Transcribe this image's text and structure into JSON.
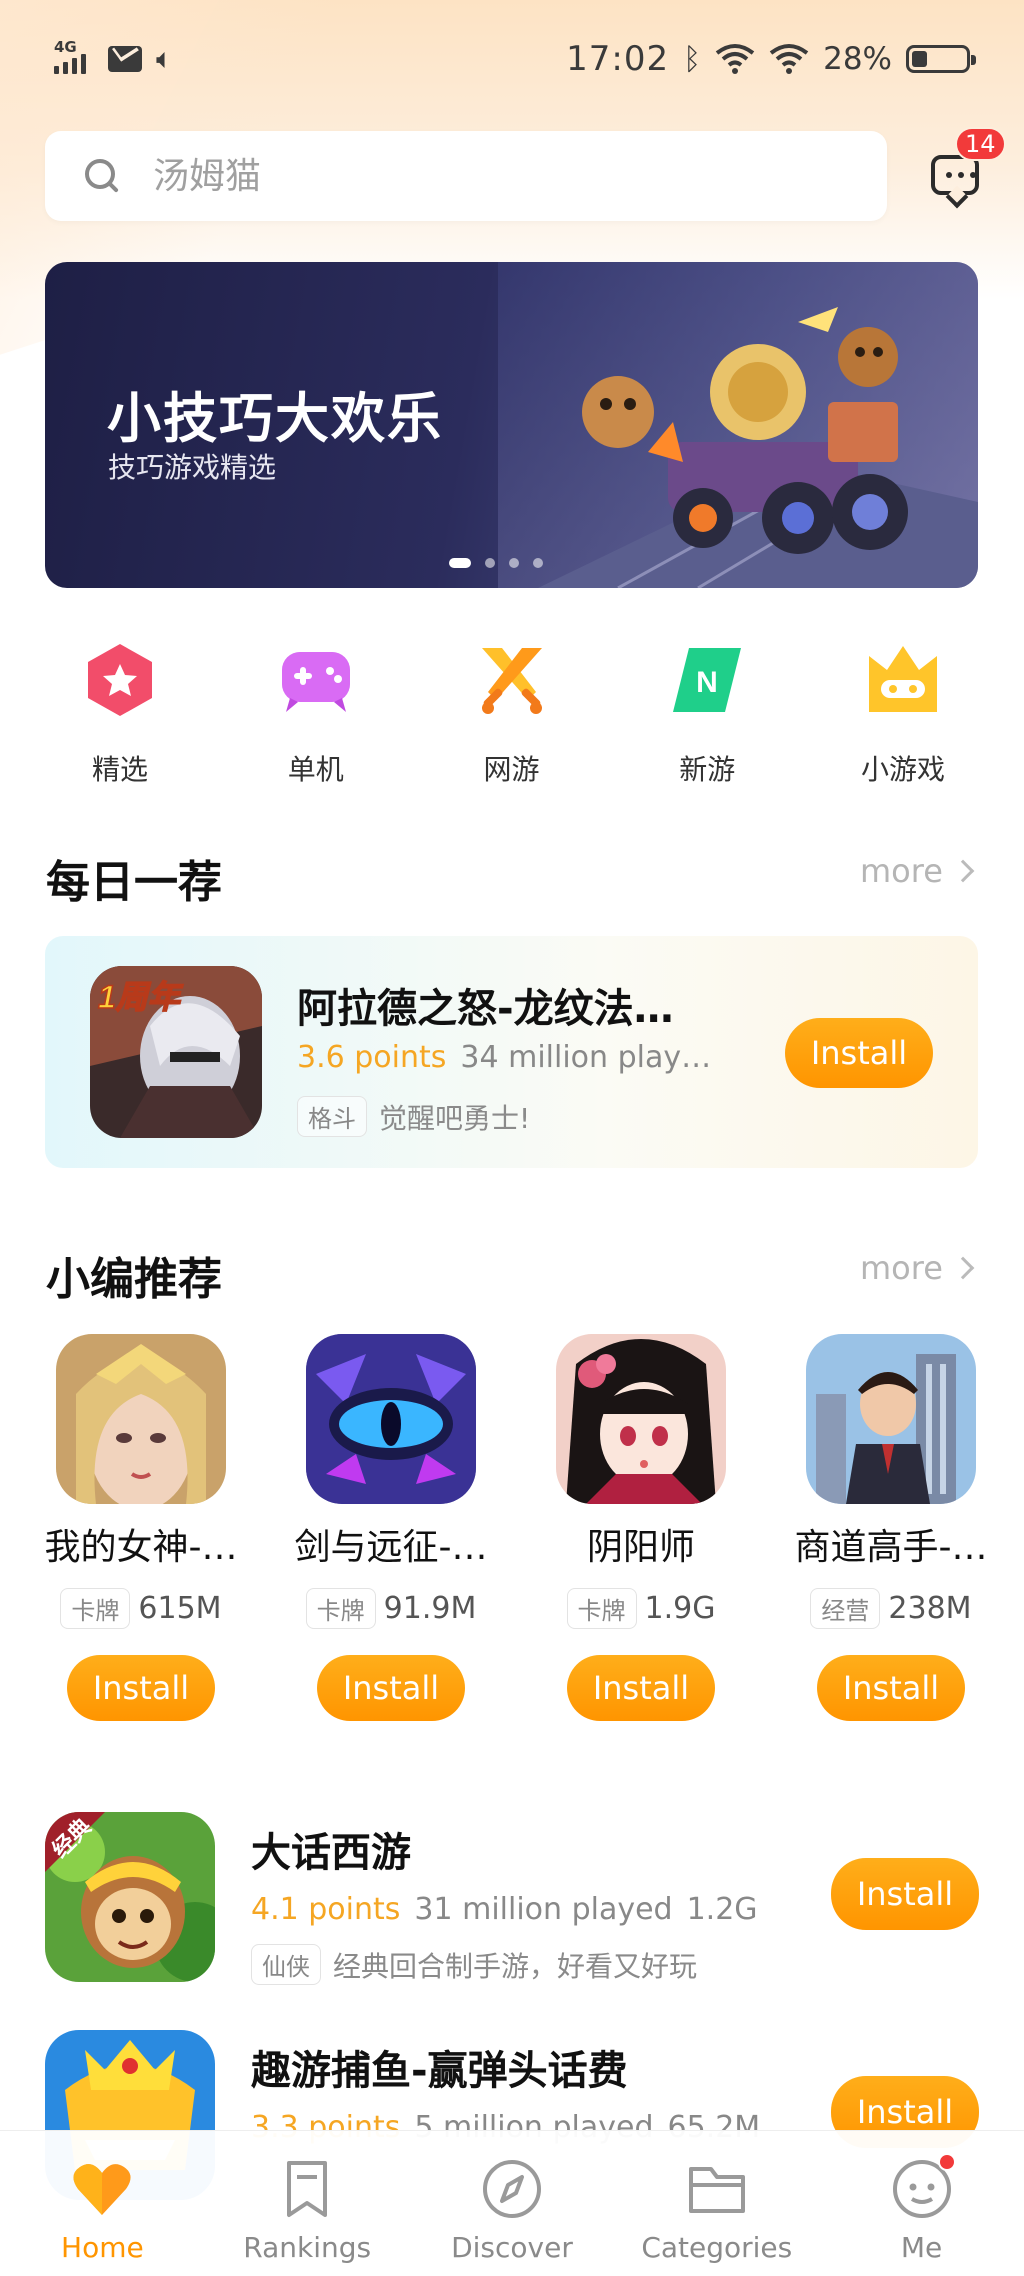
{
  "status_bar": {
    "network": "4G",
    "time": "17:02",
    "battery": "28%",
    "battery_level": 0.28
  },
  "search": {
    "placeholder": "汤姆猫",
    "messages_badge": "14"
  },
  "banner": {
    "title": "小技巧大欢乐",
    "subtitle": "技巧游戏精选",
    "active_slide": 1,
    "slide_count": 4
  },
  "categories": [
    {
      "label": "精选",
      "icon": "star-hexagon-icon"
    },
    {
      "label": "单机",
      "icon": "gamepad-icon"
    },
    {
      "label": "网游",
      "icon": "crossed-swords-icon"
    },
    {
      "label": "新游",
      "icon": "new-badge-icon"
    },
    {
      "label": "小游戏",
      "icon": "crown-icon"
    }
  ],
  "daily": {
    "title": "每日一荐",
    "more": "more",
    "app": {
      "name": "阿拉德之怒-龙纹法…",
      "points": "3.6 points",
      "played": "34 million play…",
      "tag": "格斗",
      "tagline": "觉醒吧勇士!",
      "icon_text": "1周年",
      "install": "Install"
    }
  },
  "picks": {
    "title": "小编推荐",
    "more": "more",
    "items": [
      {
        "name": "我的女神-…",
        "tag": "卡牌",
        "size": "615M",
        "install": "Install"
      },
      {
        "name": "剑与远征-…",
        "tag": "卡牌",
        "size": "91.9M",
        "install": "Install"
      },
      {
        "name": "阴阳师",
        "tag": "卡牌",
        "size": "1.9G",
        "install": "Install"
      },
      {
        "name": "商道高手-…",
        "tag": "经营",
        "size": "238M",
        "install": "Install"
      }
    ]
  },
  "list": [
    {
      "name": "大话西游",
      "points": "4.1 points",
      "played": "31 million played",
      "size": "1.2G",
      "tag": "仙侠",
      "tagline": "经典回合制手游，好看又好玩",
      "icon_text": "经典",
      "install": "Install"
    },
    {
      "name": "趣游捕鱼-赢弹头话费",
      "points": "3.3 points",
      "played": "5 million played",
      "size": "65.2M",
      "tag": "",
      "tagline": "",
      "install": "Install"
    }
  ],
  "bottom_nav": [
    {
      "label": "Home",
      "icon": "heart-icon",
      "active": true
    },
    {
      "label": "Rankings",
      "icon": "bookmark-icon",
      "active": false
    },
    {
      "label": "Discover",
      "icon": "compass-icon",
      "active": false
    },
    {
      "label": "Categories",
      "icon": "folder-icon",
      "active": false
    },
    {
      "label": "Me",
      "icon": "face-icon",
      "active": false
    }
  ],
  "colors": {
    "accent": "#ff9500",
    "points": "#f5a623",
    "badge": "#f23a3a",
    "banner_bg": "#2b2c5c"
  }
}
